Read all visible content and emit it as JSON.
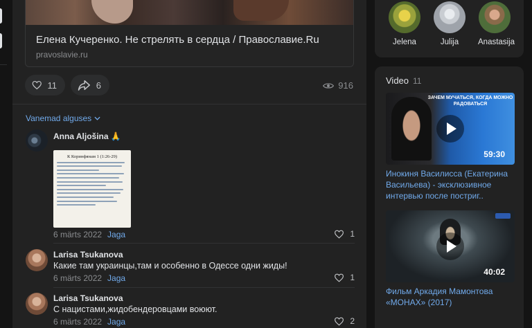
{
  "link_card": {
    "title": "Елена Кучеренко. Не стрелять в сердца / Православие.Ru",
    "domain": "pravoslavie.ru"
  },
  "actions": {
    "likes": "11",
    "shares": "6",
    "views": "916"
  },
  "comments_sort": {
    "label": "Vanemad alguses"
  },
  "comments": [
    {
      "author": "Anna Aljošina 🙏",
      "text": "",
      "date": "6 märts 2022",
      "reply": "Jaga",
      "likes": "1",
      "attachment": {
        "heading": "К Коринфянам 1 (1:26-29)"
      }
    },
    {
      "author": "Larisa Tsukanova",
      "text": "Какие там украинцы,там и особенно в Одессе одни жиды!",
      "date": "6 märts 2022",
      "reply": "Jaga",
      "likes": "1"
    },
    {
      "author": "Larisa Tsukanova",
      "text": "С нацистами,жидобендеровцами воюют.",
      "date": "6 märts 2022",
      "reply": "Jaga",
      "likes": "2"
    }
  ],
  "friends": [
    {
      "name": "Jelena"
    },
    {
      "name": "Julija"
    },
    {
      "name": "Anastasija"
    }
  ],
  "videos": {
    "heading": "Video",
    "count": "11",
    "items": [
      {
        "title": "Инокиня Василисса (Екатерина Васильева) - эксклюзивное интервью после постриг..",
        "duration": "59:30",
        "thumb_text": "ЗАЧЕМ МУЧАТЬСЯ, КОГДА МОЖНО РАДОВАТЬСЯ"
      },
      {
        "title": "Фильм Аркадия Мамонтова «МОНАХ» (2017)",
        "duration": "40:02"
      }
    ]
  },
  "colors": {
    "background": "#141414",
    "card": "#222222",
    "accent": "#71aaeb",
    "text": "#e1e3e6",
    "muted": "#8a8c8f"
  }
}
